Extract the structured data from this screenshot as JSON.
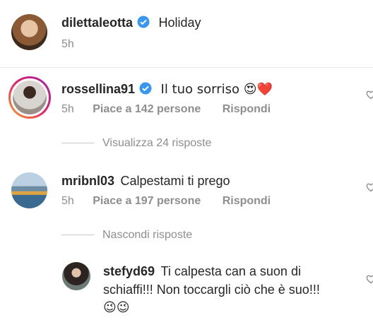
{
  "comments": [
    {
      "username": "dilettaleotta",
      "verified": true,
      "text": "Holiday",
      "time": "5h"
    },
    {
      "username": "rossellina91",
      "verified": true,
      "text": "Il tuo sorriso 😍❤️",
      "time": "5h",
      "likes": "Piace a 142 persone",
      "reply": "Rispondi",
      "replies_toggle": "Visualizza 24 risposte"
    },
    {
      "username": "mribnl03",
      "verified": false,
      "text": "Calpestami ti prego",
      "time": "5h",
      "likes": "Piace a 197 persone",
      "reply": "Rispondi",
      "replies_toggle": "Nascondi risposte"
    }
  ],
  "reply": {
    "username": "stefyd69",
    "text_line1": "Ti calpesta can a suon di",
    "text_line2": "schiaffi!!! Non toccargli ciò che è suo!!!",
    "text_line3": "😉😉"
  },
  "colors": {
    "verified": "#3897f0",
    "muted": "#8e8e8e",
    "text": "#262626"
  }
}
